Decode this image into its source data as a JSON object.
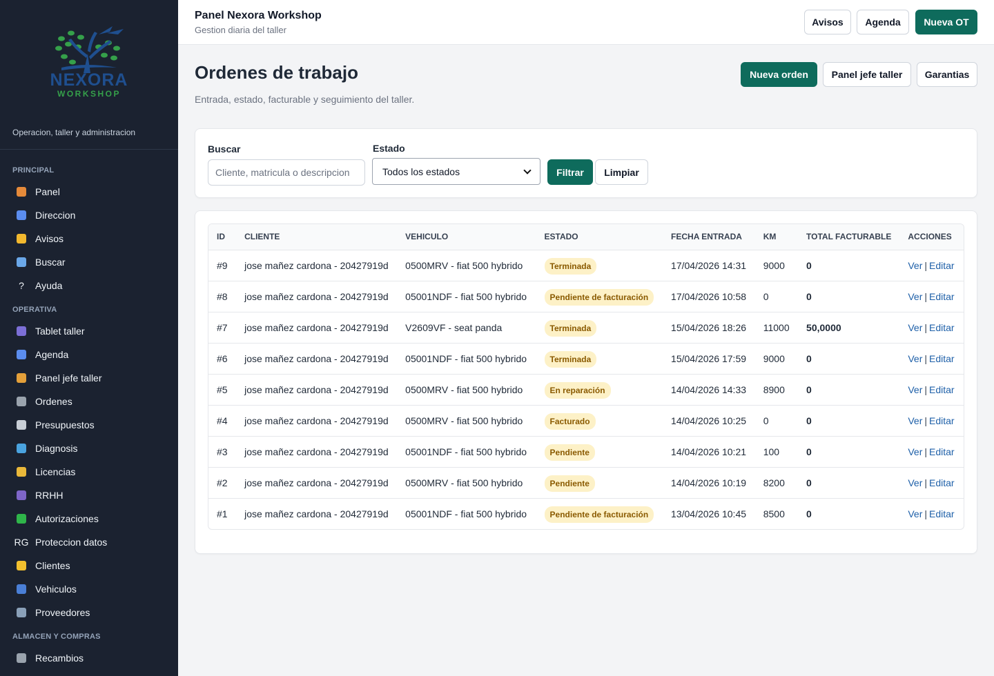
{
  "brand": {
    "logo_line1": "NEXORA",
    "logo_line2": "WORKSHOP",
    "tagline": "Operacion, taller y administracion"
  },
  "sidebar": {
    "sections": [
      {
        "title": "PRINCIPAL",
        "items": [
          {
            "label": "Panel",
            "icon": "home-icon"
          },
          {
            "label": "Direccion",
            "icon": "chart-icon"
          },
          {
            "label": "Avisos",
            "icon": "bell-icon"
          },
          {
            "label": "Buscar",
            "icon": "search-icon"
          },
          {
            "label": "Ayuda",
            "icon": "question-icon"
          }
        ]
      },
      {
        "title": "OPERATIVA",
        "items": [
          {
            "label": "Tablet taller",
            "icon": "calculator-icon"
          },
          {
            "label": "Agenda",
            "icon": "calendar-icon"
          },
          {
            "label": "Panel jefe taller",
            "icon": "compass-icon"
          },
          {
            "label": "Ordenes",
            "icon": "tools-icon"
          },
          {
            "label": "Presupuestos",
            "icon": "receipt-icon"
          },
          {
            "label": "Diagnosis",
            "icon": "laptop-icon"
          },
          {
            "label": "Licencias",
            "icon": "key-icon"
          },
          {
            "label": "RRHH",
            "icon": "people-icon"
          },
          {
            "label": "Autorizaciones",
            "icon": "check-icon"
          },
          {
            "label": "Proteccion datos",
            "icon": "rg-icon",
            "icon_text": "RG"
          },
          {
            "label": "Clientes",
            "icon": "handshake-icon"
          },
          {
            "label": "Vehiculos",
            "icon": "car-icon"
          },
          {
            "label": "Proveedores",
            "icon": "building-icon"
          }
        ]
      },
      {
        "title": "ALMACEN Y COMPRAS",
        "items": [
          {
            "label": "Recambios",
            "icon": "gear-icon"
          }
        ]
      }
    ]
  },
  "topbar": {
    "title": "Panel Nexora Workshop",
    "subtitle": "Gestion diaria del taller",
    "buttons": {
      "avisos": "Avisos",
      "agenda": "Agenda",
      "nueva_ot": "Nueva OT"
    }
  },
  "page": {
    "title": "Ordenes de trabajo",
    "description": "Entrada, estado, facturable y seguimiento del taller.",
    "actions": {
      "nueva_orden": "Nueva orden",
      "panel_jefe": "Panel jefe taller",
      "garantias": "Garantias"
    }
  },
  "filters": {
    "search_label": "Buscar",
    "search_placeholder": "Cliente, matricula o descripcion",
    "status_label": "Estado",
    "status_selected": "Todos los estados",
    "filter_button": "Filtrar",
    "clear_button": "Limpiar"
  },
  "table": {
    "columns": [
      "ID",
      "CLIENTE",
      "VEHICULO",
      "ESTADO",
      "FECHA ENTRADA",
      "KM",
      "TOTAL FACTURABLE",
      "ACCIONES"
    ],
    "action_view": "Ver",
    "action_edit": "Editar",
    "action_sep": "|",
    "rows": [
      {
        "id": "#9",
        "cliente": "jose mañez cardona - 20427919d",
        "vehiculo": "0500MRV - fiat 500 hybrido",
        "estado": "Terminada",
        "fecha": "17/04/2026 14:31",
        "km": "9000",
        "total": "0"
      },
      {
        "id": "#8",
        "cliente": "jose mañez cardona - 20427919d",
        "vehiculo": "05001NDF - fiat 500 hybrido",
        "estado": "Pendiente de facturación",
        "fecha": "17/04/2026 10:58",
        "km": "0",
        "total": "0"
      },
      {
        "id": "#7",
        "cliente": "jose mañez cardona - 20427919d",
        "vehiculo": "V2609VF - seat panda",
        "estado": "Terminada",
        "fecha": "15/04/2026 18:26",
        "km": "11000",
        "total": "50,0000"
      },
      {
        "id": "#6",
        "cliente": "jose mañez cardona - 20427919d",
        "vehiculo": "05001NDF - fiat 500 hybrido",
        "estado": "Terminada",
        "fecha": "15/04/2026 17:59",
        "km": "9000",
        "total": "0"
      },
      {
        "id": "#5",
        "cliente": "jose mañez cardona - 20427919d",
        "vehiculo": "0500MRV - fiat 500 hybrido",
        "estado": "En reparación",
        "fecha": "14/04/2026 14:33",
        "km": "8900",
        "total": "0"
      },
      {
        "id": "#4",
        "cliente": "jose mañez cardona - 20427919d",
        "vehiculo": "0500MRV - fiat 500 hybrido",
        "estado": "Facturado",
        "fecha": "14/04/2026 10:25",
        "km": "0",
        "total": "0"
      },
      {
        "id": "#3",
        "cliente": "jose mañez cardona - 20427919d",
        "vehiculo": "05001NDF - fiat 500 hybrido",
        "estado": "Pendiente",
        "fecha": "14/04/2026 10:21",
        "km": "100",
        "total": "0"
      },
      {
        "id": "#2",
        "cliente": "jose mañez cardona - 20427919d",
        "vehiculo": "0500MRV - fiat 500 hybrido",
        "estado": "Pendiente",
        "fecha": "14/04/2026 10:19",
        "km": "8200",
        "total": "0"
      },
      {
        "id": "#1",
        "cliente": "jose mañez cardona - 20427919d",
        "vehiculo": "05001NDF - fiat 500 hybrido",
        "estado": "Pendiente de facturación",
        "fecha": "13/04/2026 10:45",
        "km": "8500",
        "total": "0"
      }
    ]
  },
  "colors": {
    "sidebar_bg": "#1b2230",
    "primary": "#0e6b5c",
    "badge_bg": "#fdf1c7",
    "badge_text": "#8a5a00",
    "link": "#1d5fa8"
  }
}
